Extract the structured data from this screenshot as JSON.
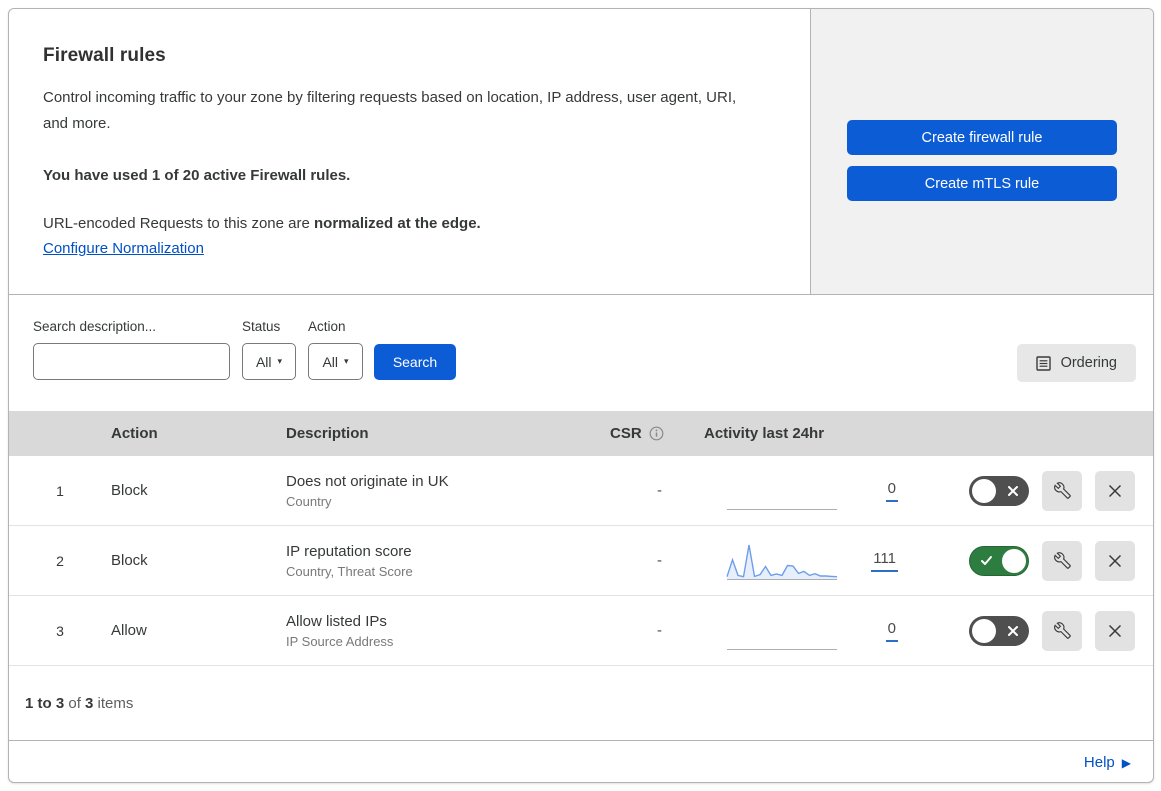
{
  "hero": {
    "title": "Firewall rules",
    "description": "Control incoming traffic to your zone by filtering requests based on location, IP address, user agent, URI, and more.",
    "usage": "You have used 1 of 20 active Firewall rules.",
    "normalization_prefix": "URL-encoded Requests to this zone are ",
    "normalization_bold": "normalized at the edge.",
    "normalization_link": "Configure Normalization",
    "create_firewall_button": "Create firewall rule",
    "create_mtls_button": "Create mTLS rule"
  },
  "filters": {
    "search_label": "Search description...",
    "status_label": "Status",
    "status_value": "All",
    "action_label": "Action",
    "action_value": "All",
    "search_button": "Search",
    "ordering_button": "Ordering"
  },
  "table": {
    "columns": {
      "action": "Action",
      "description": "Description",
      "csr": "CSR",
      "activity": "Activity last 24hr"
    },
    "rows": [
      {
        "index": "1",
        "action": "Block",
        "description": "Does not originate in UK",
        "fields": "Country",
        "csr": "-",
        "activity_count": "0",
        "enabled": false,
        "sparkline": []
      },
      {
        "index": "2",
        "action": "Block",
        "description": "IP reputation score",
        "fields": "Country, Threat Score",
        "csr": "-",
        "activity_count": "111",
        "enabled": true,
        "sparkline": [
          4,
          55,
          8,
          4,
          100,
          5,
          10,
          35,
          8,
          12,
          8,
          38,
          36,
          14,
          20,
          8,
          13,
          6,
          6,
          5,
          4
        ]
      },
      {
        "index": "3",
        "action": "Allow",
        "description": "Allow listed IPs",
        "fields": "IP Source Address",
        "csr": "-",
        "activity_count": "0",
        "enabled": false,
        "sparkline": []
      }
    ]
  },
  "footer": {
    "range": "1 to 3",
    "of_text": " of ",
    "total": "3",
    "items_text": " items",
    "help_label": "Help"
  },
  "colors": {
    "accent_blue": "#0b5cd5",
    "link_blue": "#0051c3",
    "toggle_on_green": "#2e7d40",
    "toggle_off_gray": "#4f4f4f",
    "panel_gray": "#f1f1f1",
    "table_header_gray": "#d9d9d9",
    "sparkline_blue": "#6d9eea"
  }
}
